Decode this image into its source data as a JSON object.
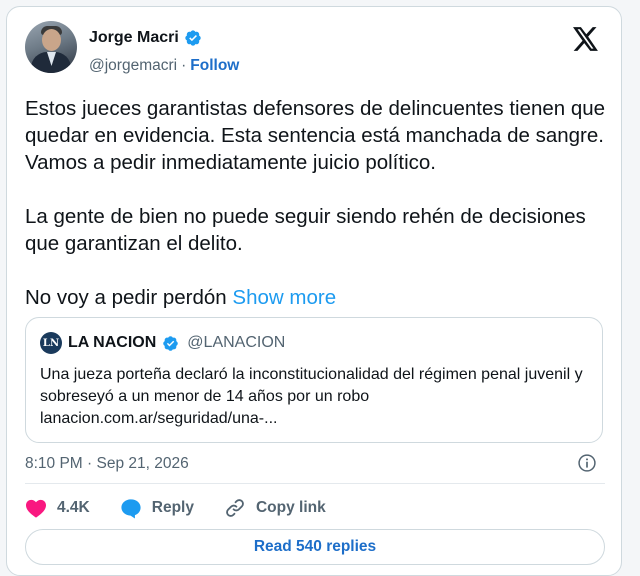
{
  "author": {
    "name": "Jorge Macri",
    "handle": "@jorgemacri",
    "separator": "·",
    "follow_label": "Follow",
    "avatar_icon": "user-avatar-photo",
    "verified_icon": "verified-badge-icon"
  },
  "platform_icon": "x-logo-icon",
  "tweet": {
    "para1": "Estos jueces garantistas defensores de delincuentes tienen que quedar en evidencia. Esta sentencia está manchada de sangre. Vamos a pedir inmediatamente juicio político.",
    "para2": "La gente de bien no puede seguir siendo rehén de decisiones que garantizan el delito.",
    "para3": "No voy a pedir perdón",
    "show_more": "Show more"
  },
  "quote": {
    "logo_text": "LN",
    "name": "LA NACION",
    "handle": "@LANACION",
    "text": "Una jueza porteña declaró la inconstitucionalidad del régimen penal juvenil y sobreseyó a un menor de 14 años por un robo lanacion.com.ar/seguridad/una-..."
  },
  "timestamp": "8:10 PM · Sep 21, 2026",
  "actions": {
    "likes": "4.4K",
    "reply": "Reply",
    "copy_link": "Copy link"
  },
  "read_replies": "Read 540 replies",
  "colors": {
    "accent": "#1d9bf0",
    "link": "#1d6ec9",
    "like": "#f91880",
    "muted": "#536471"
  }
}
